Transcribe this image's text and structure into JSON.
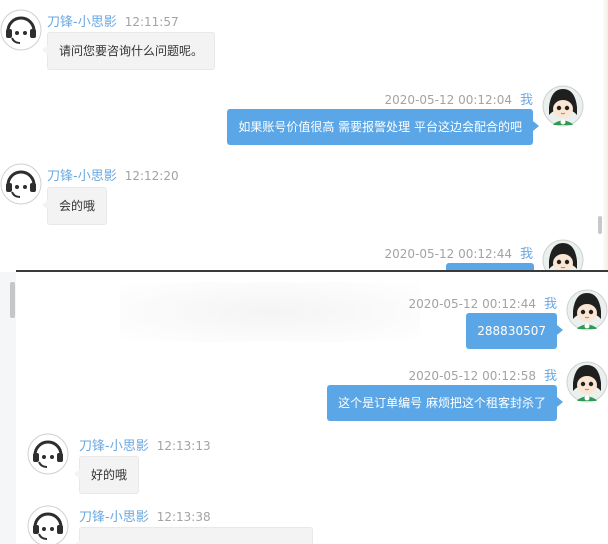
{
  "top_panel": {
    "messages": [
      {
        "side": "in",
        "name": "刀锋-小思影",
        "time": "12:11:57",
        "text": "请问您要咨询什么问题呢。",
        "avatar_icon": "headset-support-icon"
      },
      {
        "side": "out",
        "time": "2020-05-12 00:12:04",
        "sender": "我",
        "text": "如果账号价值很高 需要报警处理 平台这边会配合的吧",
        "avatar_icon": "girl-avatar-icon"
      },
      {
        "side": "in",
        "name": "刀锋-小思影",
        "time": "12:12:20",
        "text": "会的哦",
        "avatar_icon": "headset-support-icon"
      },
      {
        "side": "out",
        "time": "2020-05-12 00:12:44",
        "sender": "我",
        "text": "",
        "avatar_icon": "girl-avatar-icon"
      }
    ]
  },
  "bottom_panel": {
    "messages": [
      {
        "side": "out",
        "time": "2020-05-12 00:12:44",
        "sender": "我",
        "text": "288830507",
        "avatar_icon": "girl-avatar-icon"
      },
      {
        "side": "out",
        "time": "2020-05-12 00:12:58",
        "sender": "我",
        "text": "这个是订单编号 麻烦把这个租客封杀了",
        "avatar_icon": "girl-avatar-icon"
      },
      {
        "side": "in",
        "name": "刀锋-小思影",
        "time": "12:13:13",
        "text": "好的哦",
        "avatar_icon": "headset-support-icon"
      },
      {
        "side": "in",
        "name": "刀锋-小思影",
        "time": "12:13:38",
        "text": "",
        "avatar_icon": "headset-support-icon"
      }
    ]
  },
  "colors": {
    "accent_blue": "#5aa6e6",
    "name_blue": "#6aa8e0",
    "timestamp_gray": "#a3a3a3",
    "incoming_bubble": "#f3f3f3"
  }
}
